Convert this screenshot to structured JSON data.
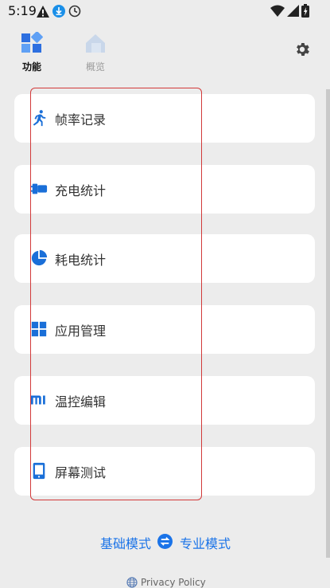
{
  "status_bar": {
    "time": "5:19",
    "icons": [
      "warning-icon",
      "download-icon",
      "clock-icon",
      "wifi-icon",
      "signal-icon",
      "battery-icon"
    ]
  },
  "tabs": [
    {
      "label": "功能",
      "icon": "grid-icon",
      "active": true
    },
    {
      "label": "概览",
      "icon": "home-icon",
      "active": false
    }
  ],
  "settings_icon": "gear-icon",
  "cards": [
    {
      "label": "帧率记录",
      "icon": "running-icon"
    },
    {
      "label": "充电统计",
      "icon": "charger-icon"
    },
    {
      "label": "耗电统计",
      "icon": "pie-icon"
    },
    {
      "label": "应用管理",
      "icon": "apps-grid-icon"
    },
    {
      "label": "温控编辑",
      "icon": "mi-logo-icon"
    },
    {
      "label": "屏幕测试",
      "icon": "phone-screen-icon"
    }
  ],
  "mode": {
    "basic": "基础模式",
    "pro": "专业模式",
    "switch_icon": "swap-icon"
  },
  "privacy": {
    "text": "Privacy Policy",
    "icon": "globe-icon"
  },
  "colors": {
    "accent": "#1a73e8",
    "icon_blue": "#1a6fd8",
    "highlight": "#d23a3a",
    "background": "#ececec"
  }
}
